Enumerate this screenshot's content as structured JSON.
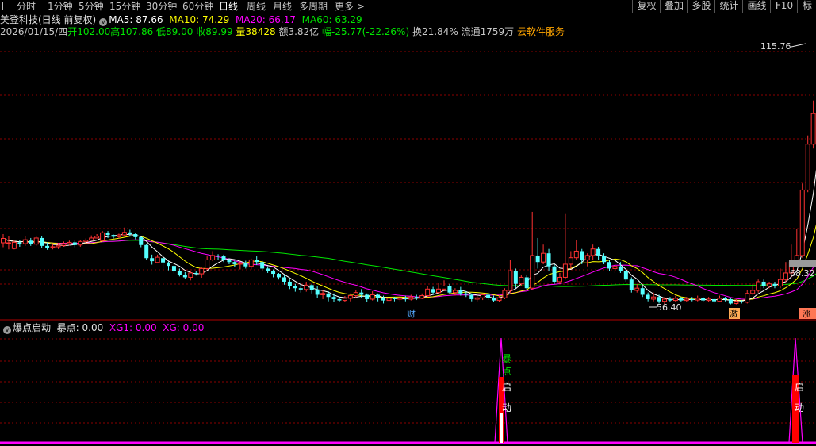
{
  "toolbar": {
    "periods": [
      "分时",
      "1分钟",
      "5分钟",
      "15分钟",
      "30分钟",
      "60分钟",
      "日线",
      "周线",
      "月线",
      "多周期",
      "更多 >"
    ],
    "active_period": "日线",
    "right_buttons": [
      "复权",
      "叠加",
      "多股",
      "统计",
      "画线",
      "F10",
      "标"
    ]
  },
  "header": {
    "stock_name": "美登科技(日线 前复权)",
    "ma5": "MA5: 87.66",
    "ma10": "MA10: 74.29",
    "ma20": "MA20: 66.17",
    "ma60": "MA60: 63.29",
    "date": "2026/01/15/四",
    "open": "开102.00",
    "high": "高107.86",
    "low": "低89.00",
    "close": "收89.99",
    "volume": "量38428",
    "amount": "额3.82亿",
    "change": "幅-25.77(-22.26%)",
    "turnover": "换21.84%",
    "float": "流通1759万",
    "sector": "云软件服务"
  },
  "indicator": {
    "name": "爆点启动",
    "baodian": "暴点: 0.00",
    "xg1": "XG1: 0.00",
    "xg": "XG: 0.00",
    "label_baodian": "暴点",
    "label_qidong": "启动"
  },
  "colors": {
    "background": "#000000",
    "up": "#ff3232",
    "down": "#54ffff",
    "ma5": "#ffffff",
    "ma10": "#ffff00",
    "ma20": "#ff00ff",
    "ma60": "#00e600",
    "grid": "#8b0000",
    "indicator": "#ff00ff",
    "signal": "#ff0000"
  },
  "chart_data": {
    "type": "candlestick",
    "price_labels": {
      "high": "115.76",
      "low": "56.40",
      "current": "68.32"
    },
    "markers": [
      "财",
      "激",
      "涨"
    ],
    "candles": [
      [
        70.5,
        71.5,
        69.5,
        72.5
      ],
      [
        70.5,
        70.5,
        69,
        72
      ],
      [
        69.2,
        70.6,
        69,
        71
      ],
      [
        70.6,
        70.3,
        69.6,
        71.2
      ],
      [
        70.3,
        71.2,
        69.8,
        72
      ],
      [
        71,
        70.2,
        69.8,
        71.6
      ],
      [
        70.2,
        71.6,
        69.8,
        72
      ],
      [
        71.6,
        69.8,
        69.4,
        72
      ],
      [
        69.8,
        69.4,
        68.9,
        70.6
      ],
      [
        69.4,
        69.6,
        69,
        70.2
      ],
      [
        69.6,
        69.9,
        69.1,
        70.4
      ],
      [
        69.9,
        70.3,
        69.6,
        70.8
      ],
      [
        70.3,
        70.6,
        69.9,
        71
      ],
      [
        70.6,
        70,
        69.5,
        71
      ],
      [
        70,
        70.8,
        69.6,
        71.2
      ],
      [
        70.8,
        71.1,
        70.4,
        71.5
      ],
      [
        71.1,
        71.6,
        71,
        72.2
      ],
      [
        71.6,
        72,
        71.5,
        72.5
      ],
      [
        71,
        72.8,
        70.8,
        73.2
      ],
      [
        72.8,
        72.3,
        71.6,
        73.2
      ],
      [
        72.3,
        71.9,
        71.5,
        72.4
      ],
      [
        71.9,
        72.3,
        71.5,
        72.6
      ],
      [
        72.3,
        72.9,
        72,
        74
      ],
      [
        72.9,
        72.5,
        72,
        73.5
      ],
      [
        72.5,
        71.8,
        71.3,
        72.8
      ],
      [
        71.8,
        70,
        69.5,
        71.8
      ],
      [
        70,
        67,
        66.5,
        70.3
      ],
      [
        67,
        66.3,
        65.5,
        67.8
      ],
      [
        66,
        67.2,
        65.8,
        67.8
      ],
      [
        67,
        66,
        64.5,
        67.4
      ],
      [
        66,
        65.2,
        64.2,
        66.2
      ],
      [
        65.2,
        64,
        63.5,
        65.4
      ],
      [
        64,
        63.2,
        62.8,
        64.6
      ],
      [
        63.2,
        62.6,
        62.2,
        63.8
      ],
      [
        62.6,
        63.6,
        61.9,
        64
      ],
      [
        63.6,
        63.4,
        63,
        64
      ],
      [
        63.4,
        64.6,
        62.5,
        65
      ],
      [
        64.6,
        66.6,
        64.3,
        67.4
      ],
      [
        66.6,
        67.6,
        66.3,
        68.6
      ],
      [
        67.6,
        67.4,
        66.6,
        67.9
      ],
      [
        67.4,
        66.6,
        66.1,
        67.8
      ],
      [
        66.6,
        66.1,
        65.6,
        66.8
      ],
      [
        66.1,
        65.6,
        64.9,
        66.4
      ],
      [
        65.6,
        65.8,
        64.4,
        66.2
      ],
      [
        65.8,
        65.1,
        64.6,
        66.4
      ],
      [
        65.1,
        66.6,
        64.4,
        66.9
      ],
      [
        66.6,
        66.1,
        65.4,
        67.4
      ],
      [
        66.1,
        64.6,
        64.2,
        66.4
      ],
      [
        64.6,
        64.1,
        63.6,
        65.1
      ],
      [
        64.1,
        63.4,
        62.6,
        64.4
      ],
      [
        63.4,
        62.6,
        62.1,
        63.6
      ],
      [
        62.6,
        61.6,
        60.9,
        63.1
      ],
      [
        61.6,
        60.6,
        59.9,
        62.1
      ],
      [
        60.6,
        60.1,
        59.3,
        61.1
      ],
      [
        60.1,
        59.8,
        59.1,
        61.1
      ],
      [
        59.8,
        60.8,
        59.3,
        61.6
      ],
      [
        60.8,
        59.6,
        58.9,
        61.1
      ],
      [
        59.6,
        58.6,
        57.9,
        60.6
      ],
      [
        58.6,
        58.9,
        57.6,
        59.6
      ],
      [
        58.9,
        58.1,
        57.1,
        59.4
      ],
      [
        58.1,
        57.6,
        56.9,
        58.9
      ],
      [
        57.6,
        57.3,
        56.9,
        58.1
      ],
      [
        57.3,
        57.8,
        56.9,
        58.3
      ],
      [
        57.8,
        58.4,
        57.1,
        58.9
      ],
      [
        58.4,
        59.1,
        57.9,
        59.6
      ],
      [
        59.1,
        58.6,
        57.9,
        59.9
      ],
      [
        58.6,
        57.6,
        56.9,
        58.9
      ],
      [
        57.6,
        58.6,
        57.3,
        59.4
      ],
      [
        58.6,
        57.9,
        57.1,
        58.9
      ],
      [
        57.9,
        57.3,
        56.6,
        58.4
      ],
      [
        57.3,
        57.8,
        56.9,
        58.4
      ],
      [
        57.8,
        57.6,
        57.1,
        58.1
      ],
      [
        57.6,
        57.9,
        57.1,
        58.4
      ],
      [
        57.9,
        57.6,
        57.1,
        58.4
      ],
      [
        57.6,
        58.1,
        57.3,
        58.6
      ],
      [
        58.1,
        57.8,
        57.4,
        58.6
      ],
      [
        57.8,
        58.4,
        57.6,
        58.9
      ],
      [
        58.4,
        59.9,
        58.1,
        60.6
      ],
      [
        59.9,
        59.1,
        58.6,
        60.4
      ],
      [
        59.1,
        59.9,
        58.9,
        61.4
      ],
      [
        59.9,
        60.6,
        59.4,
        61.9
      ],
      [
        60.6,
        59.1,
        58.9,
        61.1
      ],
      [
        59.1,
        59.6,
        58.4,
        60.1
      ],
      [
        59.6,
        58.9,
        58.4,
        60.4
      ],
      [
        58.9,
        58.6,
        58.1,
        59.4
      ],
      [
        58.6,
        57.6,
        57.1,
        58.9
      ],
      [
        57.6,
        57.9,
        57.1,
        58.4
      ],
      [
        57.9,
        58.6,
        57.4,
        58.9
      ],
      [
        58.6,
        57.9,
        57.4,
        59.1
      ],
      [
        57.9,
        57.3,
        56.9,
        58.4
      ],
      [
        57.3,
        57.9,
        56.9,
        58.4
      ],
      [
        57.9,
        59.6,
        57.6,
        60.1
      ],
      [
        59.6,
        64.1,
        59.1,
        66.6
      ],
      [
        64.1,
        61.1,
        60.1,
        64.6
      ],
      [
        61.1,
        62.6,
        60.6,
        63.1
      ],
      [
        62.6,
        60.1,
        59.6,
        63.1
      ],
      [
        60.1,
        67.6,
        59.6,
        77.6
      ],
      [
        67.6,
        66.1,
        64.6,
        71.6
      ],
      [
        66.1,
        68.1,
        65.6,
        70.1
      ],
      [
        68.1,
        65.1,
        64.1,
        69.1
      ],
      [
        65.1,
        61.6,
        61.1,
        65.6
      ],
      [
        61.6,
        62.6,
        61.1,
        63.6
      ],
      [
        62.6,
        65.6,
        62.1,
        77.1
      ],
      [
        65.6,
        67.1,
        64.6,
        68.6
      ],
      [
        67.1,
        68.6,
        66.6,
        71.1
      ],
      [
        68.6,
        66.6,
        65.6,
        69.1
      ],
      [
        66.6,
        67.6,
        65.1,
        68.1
      ],
      [
        67.6,
        69.1,
        66.6,
        70.1
      ],
      [
        69.1,
        67.6,
        66.6,
        69.6
      ],
      [
        67.6,
        66.1,
        65.6,
        68.1
      ],
      [
        66.1,
        64.6,
        64.1,
        66.6
      ],
      [
        64.6,
        65.1,
        63.6,
        65.6
      ],
      [
        65.1,
        64.1,
        63.6,
        66.1
      ],
      [
        64.1,
        62.1,
        61.6,
        64.6
      ],
      [
        62.1,
        59.6,
        59.1,
        62.6
      ],
      [
        59.6,
        60.1,
        59.1,
        61.1
      ],
      [
        60.1,
        58.6,
        58.1,
        60.6
      ],
      [
        58.6,
        57.6,
        57.1,
        59.1
      ],
      [
        57.6,
        58.1,
        57.1,
        59.1
      ],
      [
        58.1,
        57.1,
        56.6,
        58.6
      ],
      [
        57.1,
        57.6,
        56.4,
        58.1
      ],
      [
        57.6,
        57.3,
        56.9,
        58.1
      ],
      [
        57.3,
        57.8,
        56.9,
        58.4
      ],
      [
        57.8,
        57.3,
        56.9,
        58.1
      ],
      [
        57.3,
        57.6,
        56.9,
        58.1
      ],
      [
        57.6,
        57.4,
        57.1,
        58.1
      ],
      [
        57.4,
        57.8,
        57.1,
        58.4
      ],
      [
        57.8,
        57.3,
        56.9,
        58.1
      ],
      [
        57.3,
        57.6,
        56.9,
        58.1
      ],
      [
        57.6,
        57.1,
        56.6,
        57.9
      ],
      [
        57.1,
        57.8,
        56.9,
        58.4
      ],
      [
        57.8,
        57.6,
        57.1,
        58.1
      ],
      [
        57.6,
        56.6,
        56.4,
        57.9
      ],
      [
        56.6,
        57.1,
        56.4,
        57.6
      ],
      [
        57.1,
        56.9,
        56.6,
        57.4
      ],
      [
        56.9,
        58.9,
        56.6,
        59.6
      ],
      [
        58.9,
        59.6,
        58.6,
        61.1
      ],
      [
        59.6,
        61.6,
        59.1,
        62.1
      ],
      [
        61.6,
        60.6,
        60.1,
        62.1
      ],
      [
        60.6,
        61.1,
        60.1,
        61.6
      ],
      [
        61.1,
        60.6,
        60.1,
        61.6
      ],
      [
        60.6,
        62.1,
        60.1,
        64.6
      ],
      [
        62.1,
        63.6,
        61.6,
        66.1
      ],
      [
        63.6,
        66.1,
        62.6,
        70.1
      ],
      [
        66.1,
        67.6,
        65.6,
        73.6
      ],
      [
        67.6,
        82.6,
        67.1,
        84.1
      ],
      [
        82.6,
        93.1,
        82.1,
        95.1
      ],
      [
        93.1,
        100.1,
        92.1,
        103.1
      ],
      [
        100.1,
        115.1,
        99.1,
        115.76
      ],
      [
        102,
        89.99,
        89,
        107.86
      ]
    ]
  }
}
